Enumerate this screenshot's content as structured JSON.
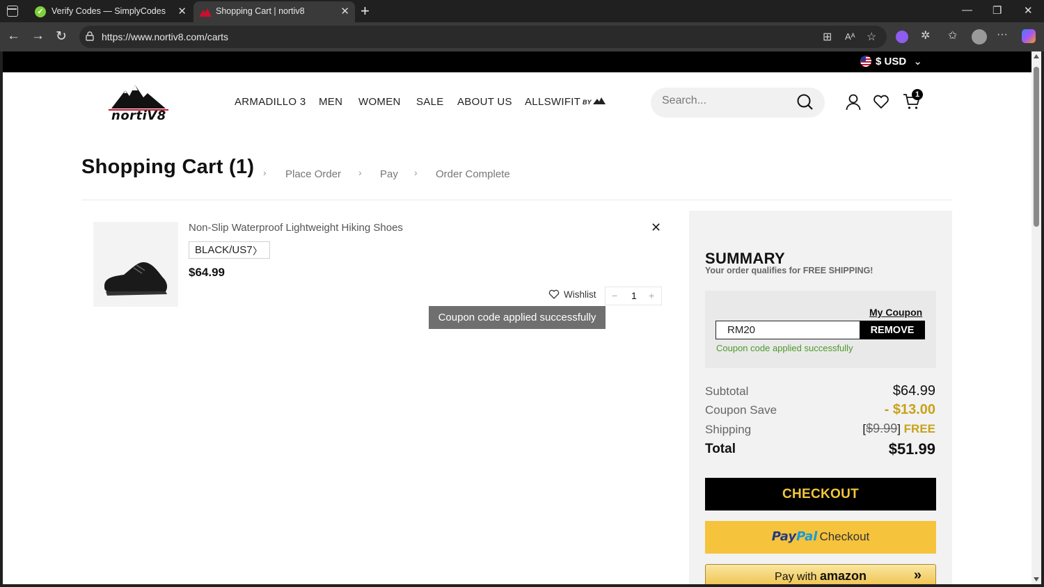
{
  "browser": {
    "tabs": [
      {
        "title": "Verify Codes — SimplyCodes",
        "active": false
      },
      {
        "title": "Shopping Cart | nortiv8",
        "active": true
      }
    ],
    "url": "https://www.nortiv8.com/carts"
  },
  "topbar": {
    "currency": "$ USD"
  },
  "header": {
    "logo_text": "nortiV8",
    "nav": [
      "ARMADILLO 3",
      "MEN",
      "WOMEN",
      "SALE",
      "ABOUT US",
      "ALLSWIFIT"
    ],
    "nav_badge": "BY",
    "search_placeholder": "Search...",
    "cart_count": "1"
  },
  "cart": {
    "title": "Shopping Cart (1)",
    "steps": [
      "Place Order",
      "Pay",
      "Order Complete"
    ],
    "item": {
      "name": "Non-Slip Waterproof Lightweight Hiking Shoes",
      "variant": "BLACK/US7",
      "price": "$64.99",
      "wishlist_label": "Wishlist",
      "quantity": "1"
    },
    "toast": "Coupon code applied successfully"
  },
  "summary": {
    "title": "SUMMARY",
    "subtitle": "Your order qualifies for FREE SHIPPING!",
    "my_coupon_label": "My Coupon",
    "coupon_code": "RM20",
    "remove_label": "REMOVE",
    "coupon_message": "Coupon code applied successfully",
    "subtotal_label": "Subtotal",
    "subtotal": "$64.99",
    "coupon_save_label": "Coupon Save",
    "coupon_save": "- $13.00",
    "shipping_label": "Shipping",
    "shipping_original": "$9.99",
    "shipping_value": "FREE",
    "total_label": "Total",
    "total": "$51.99",
    "checkout_label": "CHECKOUT",
    "paypal_pay": "Pay",
    "paypal_pal": "Pal",
    "paypal_label": "Checkout",
    "amazon_prefix": "Pay with",
    "amazon_brand": "amazon"
  },
  "colors": {
    "accent_gold": "#c7a21a",
    "checkout_text": "#f3c73a",
    "paypal_bg": "#f6c33c"
  }
}
